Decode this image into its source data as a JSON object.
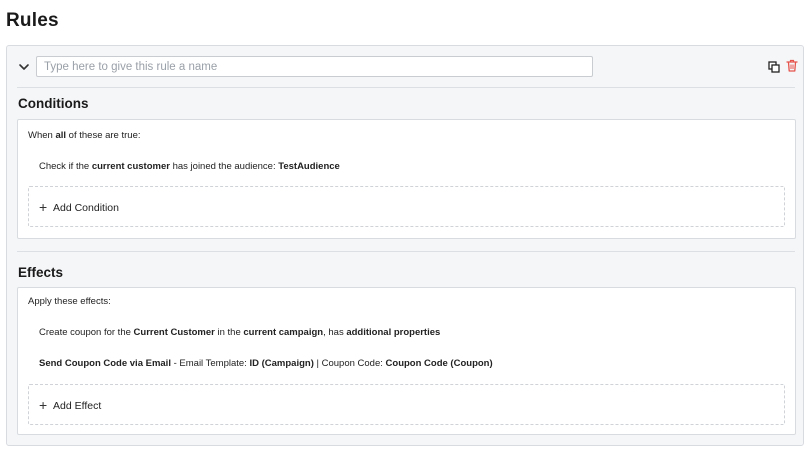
{
  "page": {
    "title": "Rules"
  },
  "rule": {
    "name_value": "",
    "name_placeholder": "Type here to give this rule a name",
    "icons": {
      "collapse": "chevron-down-icon",
      "copy": "copy-icon",
      "delete": "trash-icon"
    },
    "delete_color": "#e5534b"
  },
  "conditions": {
    "title": "Conditions",
    "intro": {
      "pre": "When ",
      "bold": "all",
      "post": " of these are true:"
    },
    "items": [
      {
        "parts": [
          {
            "t": "Check if the ",
            "b": false
          },
          {
            "t": "current customer",
            "b": true
          },
          {
            "t": " has joined the audience: ",
            "b": false
          },
          {
            "t": "TestAudience",
            "b": true
          }
        ]
      }
    ],
    "add_label": "Add Condition"
  },
  "effects": {
    "title": "Effects",
    "intro": "Apply these effects:",
    "items": [
      {
        "parts": [
          {
            "t": "Create coupon for the ",
            "b": false
          },
          {
            "t": "Current Customer",
            "b": true
          },
          {
            "t": " in the ",
            "b": false
          },
          {
            "t": "current campaign",
            "b": true
          },
          {
            "t": ", has ",
            "b": false
          },
          {
            "t": "additional properties",
            "b": true
          }
        ]
      },
      {
        "parts": [
          {
            "t": "Send Coupon Code via Email",
            "b": true
          },
          {
            "t": " - Email Template: ",
            "b": false
          },
          {
            "t": "ID (Campaign)",
            "b": true
          },
          {
            "t": " | ",
            "b": false
          },
          {
            "t": "Coupon Code: ",
            "b": false
          },
          {
            "t": "Coupon Code (Coupon)",
            "b": true
          }
        ]
      }
    ],
    "add_label": "Add Effect"
  }
}
